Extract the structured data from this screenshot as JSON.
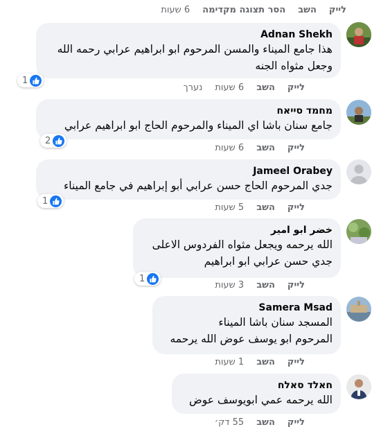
{
  "top": {
    "like": "לייק",
    "reply": "השב",
    "remove_preview": "הסר תצוגה מקדימה",
    "time": "6 שעות"
  },
  "comments": [
    {
      "name": "Adnan Shekh",
      "lines": [
        "هذا جامع الميناء والمسن المرحوم ابو ابراهيم عرابي رحمه الله",
        "وجعل مثواه الجنه"
      ],
      "reactions": "1",
      "like": "לייק",
      "reply": "השב",
      "time": "6 שעות",
      "edited": "נערך"
    },
    {
      "name": "מחמד סייאח",
      "lines": [
        "جامع سنان باشا اي الميناء والمرحوم الحاج ابو ابراهيم عرابي"
      ],
      "reactions": "2",
      "like": "לייק",
      "reply": "השב",
      "time": "6 שעות"
    },
    {
      "name": "Jameel Orabey",
      "lines": [
        "جدي المرحوم الحاج حسن عرابي أبو إبراهيم في جامع الميناء"
      ],
      "reactions": "1",
      "like": "לייק",
      "reply": "השב",
      "time": "5 שעות"
    },
    {
      "name": "خضر ابو امير",
      "lines": [
        "الله يرحمه ويجعل مثواه الفردوس الاعلى",
        "جدي حسن عرابي ابو ابراهيم"
      ],
      "reactions": "1",
      "like": "לייק",
      "reply": "השב",
      "time": "3 שעות"
    },
    {
      "name": "Samera Msad",
      "lines": [
        "المسجد سنان باشا الميناء",
        "المرحوم ابو يوسف عوض الله يرحمه"
      ],
      "like": "לייק",
      "reply": "השב",
      "time": "1 שעות"
    },
    {
      "name": "חאלד סאלח",
      "lines": [
        "الله يرحمه عمي ابويوسف عوض"
      ],
      "like": "לייק",
      "reply": "השב",
      "time": "55 דק׳"
    }
  ],
  "colors": {
    "bubble": "#f0f2f5",
    "meta": "#65676b",
    "like_blue": "#1877f2"
  }
}
